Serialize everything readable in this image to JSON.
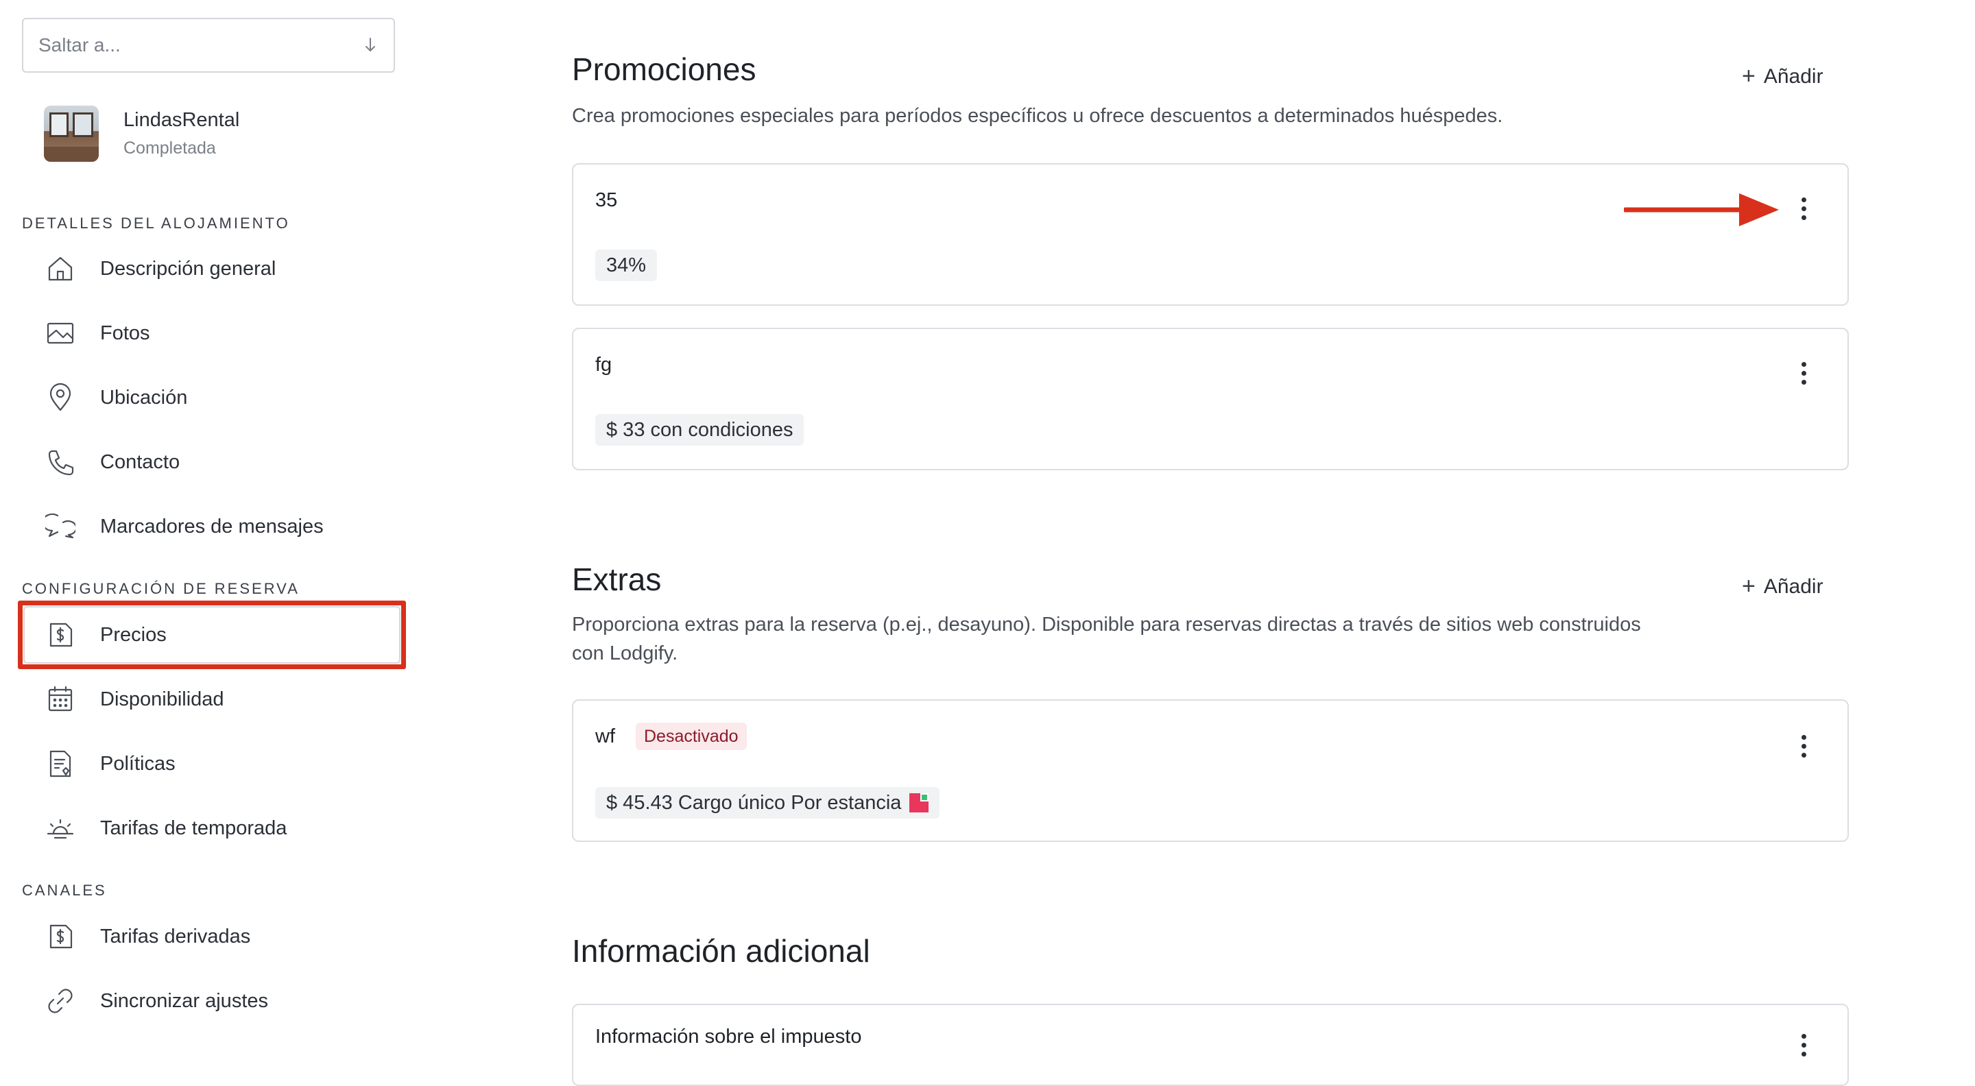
{
  "sidebar": {
    "jump_placeholder": "Saltar a...",
    "listing": {
      "name": "LindasRental",
      "status": "Completada"
    },
    "sections": {
      "details": "DETALLES DEL ALOJAMIENTO",
      "booking": "CONFIGURACIÓN DE RESERVA",
      "channels": "CANALES"
    },
    "items": {
      "overview": "Descripción general",
      "photos": "Fotos",
      "location": "Ubicación",
      "contact": "Contacto",
      "message_placeholders": "Marcadores de mensajes",
      "prices": "Precios",
      "availability": "Disponibilidad",
      "policies": "Políticas",
      "seasonal_rates": "Tarifas de temporada",
      "derived_rates": "Tarifas derivadas",
      "sync_settings": "Sincronizar ajustes"
    }
  },
  "promotions": {
    "title": "Promociones",
    "description": "Crea promociones especiales para períodos específicos u ofrece descuentos a determinados huéspedes.",
    "add_label": "Añadir",
    "cards": [
      {
        "title": "35",
        "chip": "34%"
      },
      {
        "title": "fg",
        "chip": "$ 33 con condiciones"
      }
    ]
  },
  "extras": {
    "title": "Extras",
    "description_line1": "Proporciona extras para la reserva (p.ej., desayuno). Disponible para reservas directas a través de sitios web construidos",
    "description_line2": "con Lodgify.",
    "add_label": "Añadir",
    "cards": [
      {
        "title": "wf",
        "status": "Desactivado",
        "chip": "$ 45.43 Cargo único Por estancia"
      }
    ]
  },
  "additional_info": {
    "title": "Información adicional",
    "first_card_title": "Información sobre el impuesto"
  },
  "colors": {
    "highlight": "#d9301c",
    "badge_bg": "#fbe9eb",
    "badge_text": "#8a1c28"
  }
}
